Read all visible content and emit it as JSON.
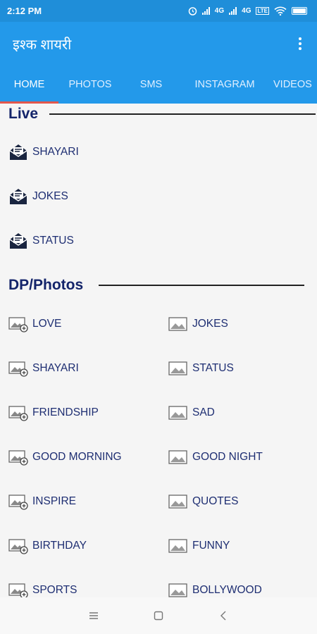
{
  "status_bar": {
    "time": "2:12 PM",
    "network1": "4G",
    "network2": "4G",
    "volte": "LTE"
  },
  "app_bar": {
    "title": "इश्क शायरी"
  },
  "tabs": [
    {
      "label": "HOME",
      "active": true
    },
    {
      "label": "PHOTOS",
      "active": false
    },
    {
      "label": "SMS",
      "active": false
    },
    {
      "label": "INSTAGRAM",
      "active": false
    },
    {
      "label": "VIDEOS",
      "active": false
    }
  ],
  "live": {
    "title": "Live",
    "items": [
      {
        "label": "SHAYARI",
        "icon": "envelope-icon"
      },
      {
        "label": "JOKES",
        "icon": "envelope-icon"
      },
      {
        "label": "STATUS",
        "icon": "envelope-icon"
      }
    ]
  },
  "photos": {
    "title": "DP/Photos",
    "left": [
      {
        "label": "LOVE",
        "icon": "image-add-icon"
      },
      {
        "label": "SHAYARI",
        "icon": "image-add-icon"
      },
      {
        "label": "FRIENDSHIP",
        "icon": "image-add-icon"
      },
      {
        "label": "GOOD MORNING",
        "icon": "image-add-icon"
      },
      {
        "label": "INSPIRE",
        "icon": "image-add-icon"
      },
      {
        "label": "BIRTHDAY",
        "icon": "image-add-icon"
      },
      {
        "label": "SPORTS",
        "icon": "image-add-icon"
      }
    ],
    "right": [
      {
        "label": "JOKES",
        "icon": "image-icon"
      },
      {
        "label": "STATUS",
        "icon": "image-icon"
      },
      {
        "label": "SAD",
        "icon": "image-icon"
      },
      {
        "label": "GOOD NIGHT",
        "icon": "image-icon"
      },
      {
        "label": "QUOTES",
        "icon": "image-icon"
      },
      {
        "label": "FUNNY",
        "icon": "image-icon"
      },
      {
        "label": "BOLLYWOOD",
        "icon": "image-icon"
      }
    ]
  },
  "colors": {
    "status_bar": "#1f8ed9",
    "app_bar": "#2399ea",
    "tab_indicator": "#e2574c",
    "text": "#1e2e72"
  }
}
